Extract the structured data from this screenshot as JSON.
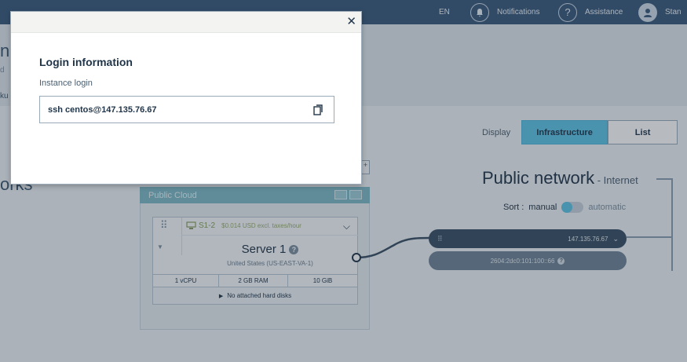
{
  "topbar": {
    "language": "EN",
    "notifications_label": "Notifications",
    "assistance_label": "Assistance",
    "user_label": "Stan"
  },
  "background": {
    "hero_title": "nS",
    "hero_sub": "d",
    "hero_tab": "ku",
    "side_heading": "orks",
    "display_label": "Display",
    "view_infrastructure": "Infrastructure",
    "view_list": "List",
    "public_network_title": "Public network",
    "public_network_sub": " - Internet",
    "sort_label": "Sort :",
    "sort_manual": "manual",
    "sort_automatic": "automatic",
    "ipv4": "147.135.76.67",
    "ipv6": "2604:2dc0:101:100::66",
    "public_cloud_label": "Public Cloud",
    "server": {
      "model": "S1-2",
      "price": "$0.014 USD excl. taxes/hour",
      "name": "Server 1",
      "region": "United States (US-EAST-VA-1)",
      "vcpu": "1 vCPU",
      "ram": "2 GB RAM",
      "disk": "10 GiB",
      "no_disks": "No attached hard disks"
    }
  },
  "modal": {
    "title": "Login information",
    "field_label": "Instance login",
    "login_command": "ssh centos@147.135.76.67"
  },
  "icons": {
    "close": "close-icon",
    "copy": "copy-icon",
    "bell": "bell-icon",
    "help": "help-icon",
    "user": "user-icon"
  },
  "colors": {
    "topbar": "#3a5a7c",
    "accent": "#5fc4e6",
    "cloud_header": "#7fb8c4"
  }
}
